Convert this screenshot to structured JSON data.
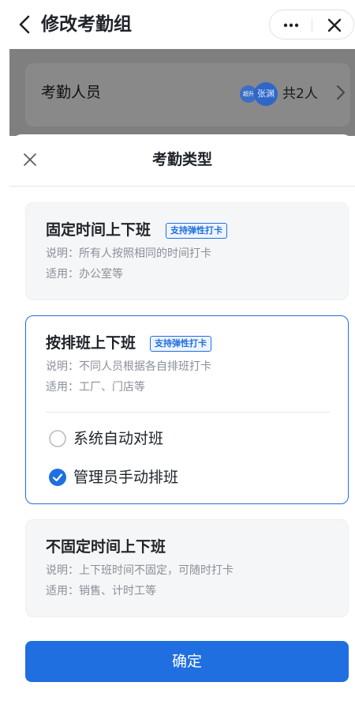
{
  "header": {
    "title": "修改考勤组",
    "back_icon": "chevron-left-icon",
    "more_icon": "more-horizontal-icon",
    "close_icon": "close-icon"
  },
  "background": {
    "members_label": "考勤人员",
    "avatar_small_text": "超升",
    "avatar_name": "张渊",
    "member_count": "共2人"
  },
  "sheet": {
    "title": "考勤类型",
    "options": [
      {
        "title": "固定时间上下班",
        "badge": "支持弹性打卡",
        "desc": "说明：所有人按照相同的时间打卡",
        "scope": "适用：办公室等",
        "selected": false
      },
      {
        "title": "按排班上下班",
        "badge": "支持弹性打卡",
        "desc": "说明：不同人员根据各自排班打卡",
        "scope": "适用：工厂、门店等",
        "selected": true,
        "sub_options": [
          {
            "label": "系统自动对班",
            "checked": false
          },
          {
            "label": "管理员手动排班",
            "checked": true
          }
        ]
      },
      {
        "title": "不固定时间上下班",
        "desc": "说明：上下班时间不固定，可随时打卡",
        "scope": "适用：销售、计时工等",
        "selected": false
      }
    ],
    "confirm_label": "确定"
  },
  "colors": {
    "accent": "#1f6fe0",
    "overlay": "#7f7f7f",
    "card_gray": "#f5f6f7",
    "text_secondary": "#8a8f99"
  }
}
